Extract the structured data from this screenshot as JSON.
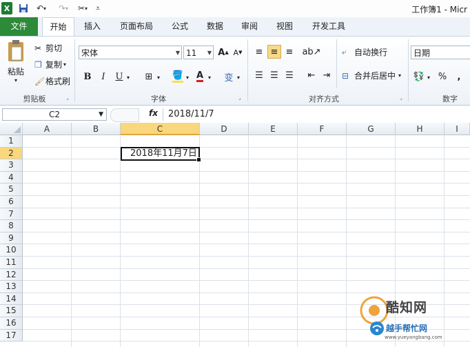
{
  "titlebar": {
    "title": "工作簿1 - Micr"
  },
  "tabs": [
    "文件",
    "开始",
    "插入",
    "页面布局",
    "公式",
    "数据",
    "审阅",
    "视图",
    "开发工具"
  ],
  "clipboard": {
    "paste": "粘贴",
    "cut": "剪切",
    "copy": "复制",
    "format_painter": "格式刷",
    "group": "剪贴板"
  },
  "font": {
    "name": "宋体",
    "size": "11",
    "bold": "B",
    "italic": "I",
    "underline": "U",
    "group": "字体",
    "grow": "A",
    "shrink": "A",
    "phonetic": "变"
  },
  "alignment": {
    "wrap": "自动换行",
    "merge": "合并后居中",
    "group": "对齐方式"
  },
  "number": {
    "format": "日期",
    "percent": "%",
    "comma": ",",
    "group": "数字"
  },
  "formula_bar": {
    "name_box": "C2",
    "fx": "fx",
    "formula": "2018/11/7"
  },
  "columns": [
    "A",
    "B",
    "C",
    "D",
    "E",
    "F",
    "G",
    "H",
    "I"
  ],
  "rows": [
    "1",
    "2",
    "3",
    "4",
    "5",
    "6",
    "7",
    "8",
    "9",
    "10",
    "11",
    "12",
    "13",
    "14",
    "15",
    "16",
    "17"
  ],
  "active_cell": {
    "ref": "C2",
    "display": "2018年11月7日"
  },
  "watermark": {
    "brand": "酷知网",
    "sub": "越手帮忙网",
    "url": "www.yueyangbang.com"
  },
  "colors": {
    "file_tab": "#2c8a39",
    "selected_header": "#f9d77d"
  }
}
